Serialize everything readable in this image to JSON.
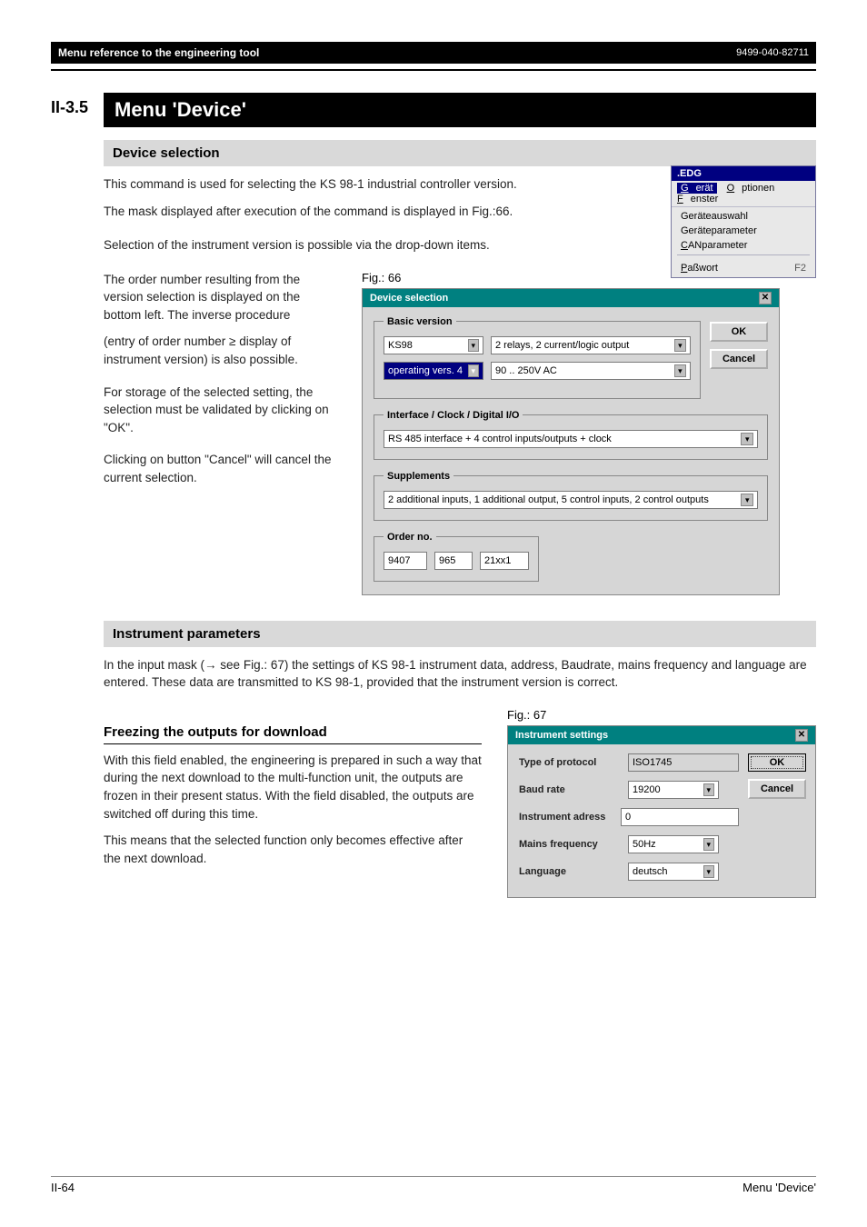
{
  "header": {
    "left": "Menu reference to the engineering tool",
    "right": "9499-040-82711"
  },
  "section": {
    "num": "II-3.5",
    "title": "Menu 'Device'"
  },
  "device_selection": {
    "heading": "Device selection",
    "p1": "This command is used for selecting the KS 98-1 industrial controller version.",
    "p2": "The mask displayed after execution of the command is displayed in Fig.:66.",
    "p3": "Selection of the instrument version is possible via the drop-down items.",
    "p4": "The order number resulting from the version selection is displayed on the bottom left. The inverse procedure",
    "p5": "(entry of order number ≥ display of instrument version) is also possible.",
    "p6": "For storage of the selected setting, the selection must be validated by clicking on \"OK\".",
    "p7": "Clicking on button \"Cancel\" will cancel the current selection."
  },
  "menu_win": {
    "title": ".EDG",
    "bar": {
      "gerat": "Gerät",
      "optionen": "Optionen",
      "fenster": "Fenster"
    },
    "items": [
      "Geräteauswahl",
      "Geräteparameter",
      "CANparameter"
    ],
    "pw": "Paßwort",
    "pw_sc": "F2"
  },
  "fig66": {
    "cap": "Fig.: 66",
    "title": "Device selection",
    "basic_legend": "Basic version",
    "ks98": "KS98",
    "relays": "2 relays, 2 current/logic output",
    "opver": "operating vers. 4",
    "volts": "90 .. 250V AC",
    "iface_legend": "Interface / Clock / Digital I/O",
    "iface_val": "RS 485 interface + 4 control inputs/outputs + clock",
    "supp_legend": "Supplements",
    "supp_val": "2 additional inputs, 1 additional output, 5 control inputs, 2 control outputs",
    "order_legend": "Order no.",
    "order_a": "9407",
    "order_b": "965",
    "order_c": "21xx1",
    "ok": "OK",
    "cancel": "Cancel"
  },
  "instr_params": {
    "heading": "Instrument parameters",
    "p1": "In the input mask (→ see Fig.: 67) the settings of KS 98-1 instrument data, address, Baudrate, mains frequency and language are entered. These data are transmitted to KS 98-1, provided that the instrument version is correct."
  },
  "freeze": {
    "heading": "Freezing the outputs for download",
    "p1": "With this field enabled, the engineering is prepared in such a way that during the next download to the multi-function unit, the outputs are frozen in their present status. With the field disabled, the outputs are switched off during this time.",
    "p2": "This means that the selected function only becomes effective after the next download."
  },
  "fig67": {
    "cap": "Fig.: 67",
    "title": "Instrument settings",
    "type_lbl": "Type of protocol",
    "type_val": "ISO1745",
    "baud_lbl": "Baud rate",
    "baud_val": "19200",
    "addr_lbl": "Instrument adress",
    "addr_val": "0",
    "mains_lbl": "Mains frequency",
    "mains_val": "50Hz",
    "lang_lbl": "Language",
    "lang_val": "deutsch",
    "ok": "OK",
    "cancel": "Cancel"
  },
  "footer": {
    "left": "II-64",
    "right": "Menu 'Device'"
  }
}
